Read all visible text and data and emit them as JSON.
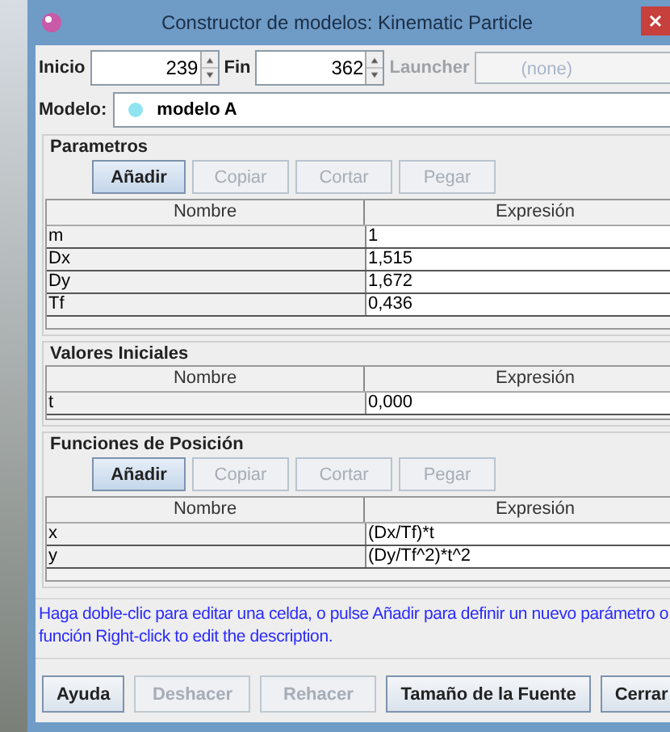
{
  "window": {
    "title": "Constructor de modelos: Kinematic Particle"
  },
  "range": {
    "start_label": "Inicio",
    "start_value": "239",
    "end_label": "Fin",
    "end_value": "362"
  },
  "launcher": {
    "label": "Launcher",
    "value": "(none)",
    "disabled": true
  },
  "model": {
    "label": "Modelo:",
    "value": "modelo A"
  },
  "sections": [
    {
      "title": "Parametros",
      "buttons": [
        {
          "label": "Añadir",
          "disabled": false
        },
        {
          "label": "Copiar",
          "disabled": true
        },
        {
          "label": "Cortar",
          "disabled": true
        },
        {
          "label": "Pegar",
          "disabled": true
        }
      ],
      "columns": [
        "Nombre",
        "Expresión"
      ],
      "rows": [
        {
          "name": "m",
          "expression": "1"
        },
        {
          "name": "Dx",
          "expression": "1,515"
        },
        {
          "name": "Dy",
          "expression": "1,672"
        },
        {
          "name": "Tf",
          "expression": "0,436"
        }
      ]
    },
    {
      "title": "Valores Iniciales",
      "columns": [
        "Nombre",
        "Expresión"
      ],
      "rows": [
        {
          "name": "t",
          "expression": "0,000"
        }
      ]
    },
    {
      "title": "Funciones de Posición",
      "buttons": [
        {
          "label": "Añadir",
          "disabled": false
        },
        {
          "label": "Copiar",
          "disabled": true
        },
        {
          "label": "Cortar",
          "disabled": true
        },
        {
          "label": "Pegar",
          "disabled": true
        }
      ],
      "columns": [
        "Nombre",
        "Expresión"
      ],
      "rows": [
        {
          "name": "x",
          "expression": "(Dx/Tf)*t"
        },
        {
          "name": "y",
          "expression": "(Dy/Tf^2)*t^2"
        }
      ]
    }
  ],
  "help_text": "Haga doble-clic para editar una celda, o pulse Añadir para definir un nuevo parámetro o función  Right-click to edit the description.",
  "footer_buttons": [
    {
      "label": "Ayuda",
      "disabled": false
    },
    {
      "label": "Deshacer",
      "disabled": true
    },
    {
      "label": "Rehacer",
      "disabled": true
    },
    {
      "label": "Tamaño de la Fuente",
      "disabled": false
    },
    {
      "label": "Cerrar",
      "disabled": false
    }
  ]
}
